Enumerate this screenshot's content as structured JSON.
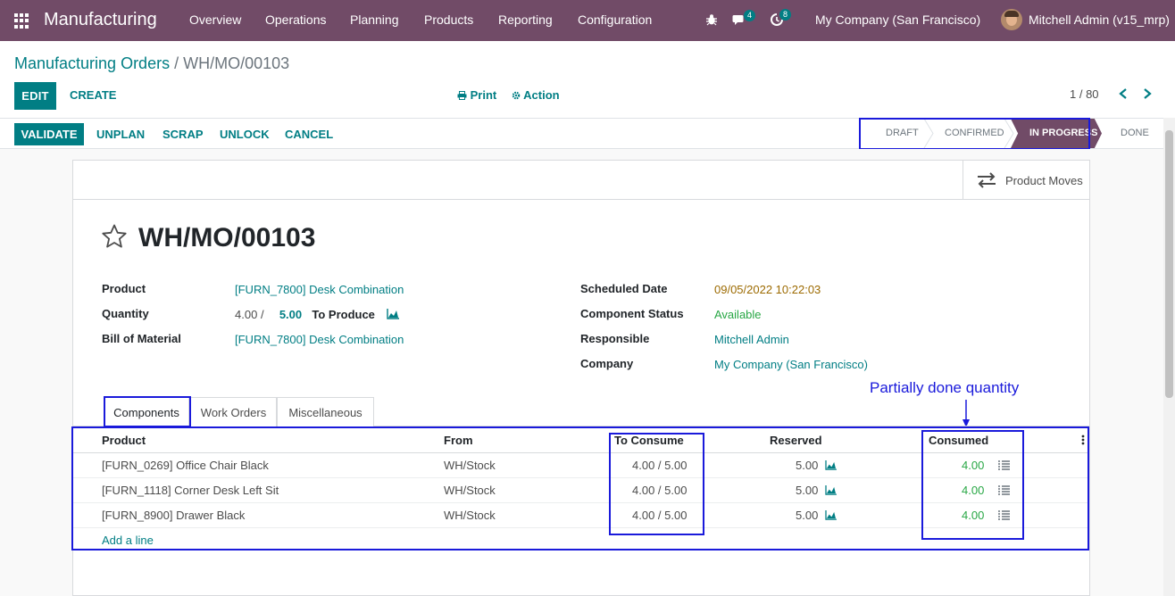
{
  "navbar": {
    "app_name": "Manufacturing",
    "menu": [
      "Overview",
      "Operations",
      "Planning",
      "Products",
      "Reporting",
      "Configuration"
    ],
    "messages_count": "4",
    "activities_count": "8",
    "company": "My Company (San Francisco)",
    "user": "Mitchell Admin (v15_mrp)"
  },
  "control": {
    "breadcrumb_parent": "Manufacturing Orders",
    "breadcrumb_sep": "/",
    "breadcrumb_current": "WH/MO/00103",
    "edit_label": "EDIT",
    "create_label": "CREATE",
    "print_label": "Print",
    "action_label": "Action",
    "pager": "1 / 80"
  },
  "statusbar": {
    "buttons": [
      "VALIDATE",
      "UNPLAN",
      "SCRAP",
      "UNLOCK",
      "CANCEL"
    ],
    "stages": [
      "DRAFT",
      "CONFIRMED",
      "IN PROGRESS",
      "DONE"
    ],
    "active_stage": "IN PROGRESS"
  },
  "form": {
    "product_moves_label": "Product Moves",
    "title": "WH/MO/00103",
    "left": {
      "product_label": "Product",
      "product_value": "[FURN_7800] Desk Combination",
      "quantity_label": "Quantity",
      "qty_done": "4.00",
      "qty_sep": "/",
      "qty_total": "5.00",
      "qty_to_produce": "To Produce",
      "bom_label": "Bill of Material",
      "bom_value": "[FURN_7800] Desk Combination"
    },
    "right": {
      "scheduled_label": "Scheduled Date",
      "scheduled_value": "09/05/2022 10:22:03",
      "component_status_label": "Component Status",
      "component_status_value": "Available",
      "responsible_label": "Responsible",
      "responsible_value": "Mitchell Admin",
      "company_label": "Company",
      "company_value": "My Company (San Francisco)"
    },
    "tabs": [
      "Components",
      "Work Orders",
      "Miscellaneous"
    ],
    "annotation": "Partially done quantity"
  },
  "components": {
    "headers": [
      "Product",
      "From",
      "To Consume",
      "Reserved",
      "Consumed"
    ],
    "rows": [
      {
        "product": "[FURN_0269] Office Chair Black",
        "from": "WH/Stock",
        "to_consume": "4.00 / 5.00",
        "reserved": "5.00",
        "consumed": "4.00"
      },
      {
        "product": "[FURN_1118] Corner Desk Left Sit",
        "from": "WH/Stock",
        "to_consume": "4.00 / 5.00",
        "reserved": "5.00",
        "consumed": "4.00"
      },
      {
        "product": "[FURN_8900] Drawer Black",
        "from": "WH/Stock",
        "to_consume": "4.00 / 5.00",
        "reserved": "5.00",
        "consumed": "4.00"
      }
    ],
    "add_line_label": "Add a line"
  },
  "colors": {
    "brand": "#714b67",
    "primary": "#017e84",
    "annotation": "#1a1adb",
    "success": "#28a745",
    "warning": "#9c6a00"
  }
}
